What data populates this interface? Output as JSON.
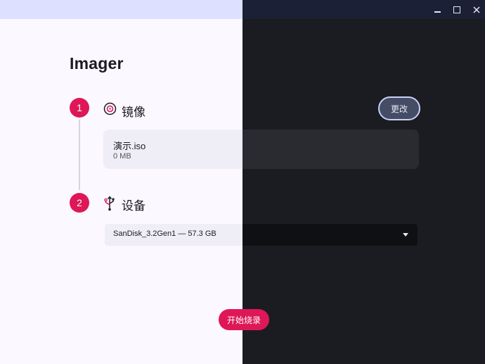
{
  "app": {
    "title": "Imager"
  },
  "window_controls": {
    "minimize_icon": "minimize-icon",
    "maximize_icon": "maximize-icon",
    "close_icon": "close-icon"
  },
  "steps": [
    {
      "number": "1",
      "label": "镜像",
      "icon": "disc-icon"
    },
    {
      "number": "2",
      "label": "设备",
      "icon": "usb-icon"
    }
  ],
  "image": {
    "name": "演示.iso",
    "size": "0 MB",
    "change_label": "更改"
  },
  "device": {
    "selected": "SanDisk_3.2Gen1 — 57.3 GB"
  },
  "actions": {
    "write_label": "开始烧录"
  },
  "colors": {
    "accent": "#de1758",
    "light_bg": "#fbf8ff",
    "dark_bg": "#1b1c21",
    "light_titlebar": "#dde1ff",
    "dark_titlebar": "#1b2036"
  }
}
